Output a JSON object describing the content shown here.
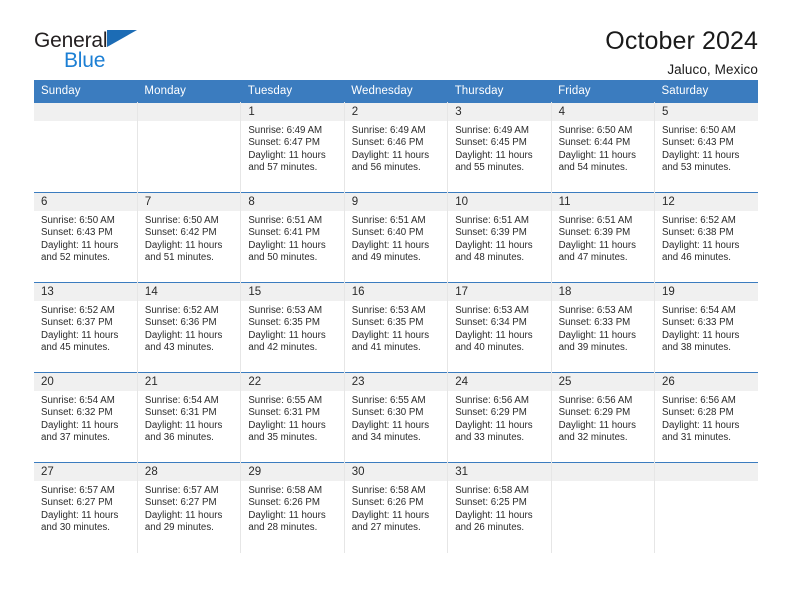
{
  "brand": {
    "word_one": "General",
    "word_two": "Blue",
    "triangle_icon": "blue-triangle-logo-mark",
    "color_dark": "#231f20",
    "color_blue": "#1c7fd4"
  },
  "header": {
    "title": "October 2024",
    "location": "Jaluco, Mexico"
  },
  "theme": {
    "header_bg": "#3b7cbf",
    "header_text": "#ffffff",
    "daynum_band_bg": "#f0f0f0",
    "cell_bg": "#ffffff",
    "grid_line": "#e6e6e6",
    "row_rule": "#3b7cbf"
  },
  "weekday_headers": [
    "Sunday",
    "Monday",
    "Tuesday",
    "Wednesday",
    "Thursday",
    "Friday",
    "Saturday"
  ],
  "labels": {
    "sunrise_prefix": "Sunrise:",
    "sunset_prefix": "Sunset:",
    "daylight_prefix": "Daylight:"
  },
  "weeks": [
    [
      {
        "day": "",
        "line1": "",
        "line2": "",
        "line3": "",
        "line4": ""
      },
      {
        "day": "",
        "line1": "",
        "line2": "",
        "line3": "",
        "line4": ""
      },
      {
        "day": "1",
        "line1": "Sunrise: 6:49 AM",
        "line2": "Sunset: 6:47 PM",
        "line3": "Daylight: 11 hours",
        "line4": "and 57 minutes."
      },
      {
        "day": "2",
        "line1": "Sunrise: 6:49 AM",
        "line2": "Sunset: 6:46 PM",
        "line3": "Daylight: 11 hours",
        "line4": "and 56 minutes."
      },
      {
        "day": "3",
        "line1": "Sunrise: 6:49 AM",
        "line2": "Sunset: 6:45 PM",
        "line3": "Daylight: 11 hours",
        "line4": "and 55 minutes."
      },
      {
        "day": "4",
        "line1": "Sunrise: 6:50 AM",
        "line2": "Sunset: 6:44 PM",
        "line3": "Daylight: 11 hours",
        "line4": "and 54 minutes."
      },
      {
        "day": "5",
        "line1": "Sunrise: 6:50 AM",
        "line2": "Sunset: 6:43 PM",
        "line3": "Daylight: 11 hours",
        "line4": "and 53 minutes."
      }
    ],
    [
      {
        "day": "6",
        "line1": "Sunrise: 6:50 AM",
        "line2": "Sunset: 6:43 PM",
        "line3": "Daylight: 11 hours",
        "line4": "and 52 minutes."
      },
      {
        "day": "7",
        "line1": "Sunrise: 6:50 AM",
        "line2": "Sunset: 6:42 PM",
        "line3": "Daylight: 11 hours",
        "line4": "and 51 minutes."
      },
      {
        "day": "8",
        "line1": "Sunrise: 6:51 AM",
        "line2": "Sunset: 6:41 PM",
        "line3": "Daylight: 11 hours",
        "line4": "and 50 minutes."
      },
      {
        "day": "9",
        "line1": "Sunrise: 6:51 AM",
        "line2": "Sunset: 6:40 PM",
        "line3": "Daylight: 11 hours",
        "line4": "and 49 minutes."
      },
      {
        "day": "10",
        "line1": "Sunrise: 6:51 AM",
        "line2": "Sunset: 6:39 PM",
        "line3": "Daylight: 11 hours",
        "line4": "and 48 minutes."
      },
      {
        "day": "11",
        "line1": "Sunrise: 6:51 AM",
        "line2": "Sunset: 6:39 PM",
        "line3": "Daylight: 11 hours",
        "line4": "and 47 minutes."
      },
      {
        "day": "12",
        "line1": "Sunrise: 6:52 AM",
        "line2": "Sunset: 6:38 PM",
        "line3": "Daylight: 11 hours",
        "line4": "and 46 minutes."
      }
    ],
    [
      {
        "day": "13",
        "line1": "Sunrise: 6:52 AM",
        "line2": "Sunset: 6:37 PM",
        "line3": "Daylight: 11 hours",
        "line4": "and 45 minutes."
      },
      {
        "day": "14",
        "line1": "Sunrise: 6:52 AM",
        "line2": "Sunset: 6:36 PM",
        "line3": "Daylight: 11 hours",
        "line4": "and 43 minutes."
      },
      {
        "day": "15",
        "line1": "Sunrise: 6:53 AM",
        "line2": "Sunset: 6:35 PM",
        "line3": "Daylight: 11 hours",
        "line4": "and 42 minutes."
      },
      {
        "day": "16",
        "line1": "Sunrise: 6:53 AM",
        "line2": "Sunset: 6:35 PM",
        "line3": "Daylight: 11 hours",
        "line4": "and 41 minutes."
      },
      {
        "day": "17",
        "line1": "Sunrise: 6:53 AM",
        "line2": "Sunset: 6:34 PM",
        "line3": "Daylight: 11 hours",
        "line4": "and 40 minutes."
      },
      {
        "day": "18",
        "line1": "Sunrise: 6:53 AM",
        "line2": "Sunset: 6:33 PM",
        "line3": "Daylight: 11 hours",
        "line4": "and 39 minutes."
      },
      {
        "day": "19",
        "line1": "Sunrise: 6:54 AM",
        "line2": "Sunset: 6:33 PM",
        "line3": "Daylight: 11 hours",
        "line4": "and 38 minutes."
      }
    ],
    [
      {
        "day": "20",
        "line1": "Sunrise: 6:54 AM",
        "line2": "Sunset: 6:32 PM",
        "line3": "Daylight: 11 hours",
        "line4": "and 37 minutes."
      },
      {
        "day": "21",
        "line1": "Sunrise: 6:54 AM",
        "line2": "Sunset: 6:31 PM",
        "line3": "Daylight: 11 hours",
        "line4": "and 36 minutes."
      },
      {
        "day": "22",
        "line1": "Sunrise: 6:55 AM",
        "line2": "Sunset: 6:31 PM",
        "line3": "Daylight: 11 hours",
        "line4": "and 35 minutes."
      },
      {
        "day": "23",
        "line1": "Sunrise: 6:55 AM",
        "line2": "Sunset: 6:30 PM",
        "line3": "Daylight: 11 hours",
        "line4": "and 34 minutes."
      },
      {
        "day": "24",
        "line1": "Sunrise: 6:56 AM",
        "line2": "Sunset: 6:29 PM",
        "line3": "Daylight: 11 hours",
        "line4": "and 33 minutes."
      },
      {
        "day": "25",
        "line1": "Sunrise: 6:56 AM",
        "line2": "Sunset: 6:29 PM",
        "line3": "Daylight: 11 hours",
        "line4": "and 32 minutes."
      },
      {
        "day": "26",
        "line1": "Sunrise: 6:56 AM",
        "line2": "Sunset: 6:28 PM",
        "line3": "Daylight: 11 hours",
        "line4": "and 31 minutes."
      }
    ],
    [
      {
        "day": "27",
        "line1": "Sunrise: 6:57 AM",
        "line2": "Sunset: 6:27 PM",
        "line3": "Daylight: 11 hours",
        "line4": "and 30 minutes."
      },
      {
        "day": "28",
        "line1": "Sunrise: 6:57 AM",
        "line2": "Sunset: 6:27 PM",
        "line3": "Daylight: 11 hours",
        "line4": "and 29 minutes."
      },
      {
        "day": "29",
        "line1": "Sunrise: 6:58 AM",
        "line2": "Sunset: 6:26 PM",
        "line3": "Daylight: 11 hours",
        "line4": "and 28 minutes."
      },
      {
        "day": "30",
        "line1": "Sunrise: 6:58 AM",
        "line2": "Sunset: 6:26 PM",
        "line3": "Daylight: 11 hours",
        "line4": "and 27 minutes."
      },
      {
        "day": "31",
        "line1": "Sunrise: 6:58 AM",
        "line2": "Sunset: 6:25 PM",
        "line3": "Daylight: 11 hours",
        "line4": "and 26 minutes."
      },
      {
        "day": "",
        "line1": "",
        "line2": "",
        "line3": "",
        "line4": ""
      },
      {
        "day": "",
        "line1": "",
        "line2": "",
        "line3": "",
        "line4": ""
      }
    ]
  ]
}
